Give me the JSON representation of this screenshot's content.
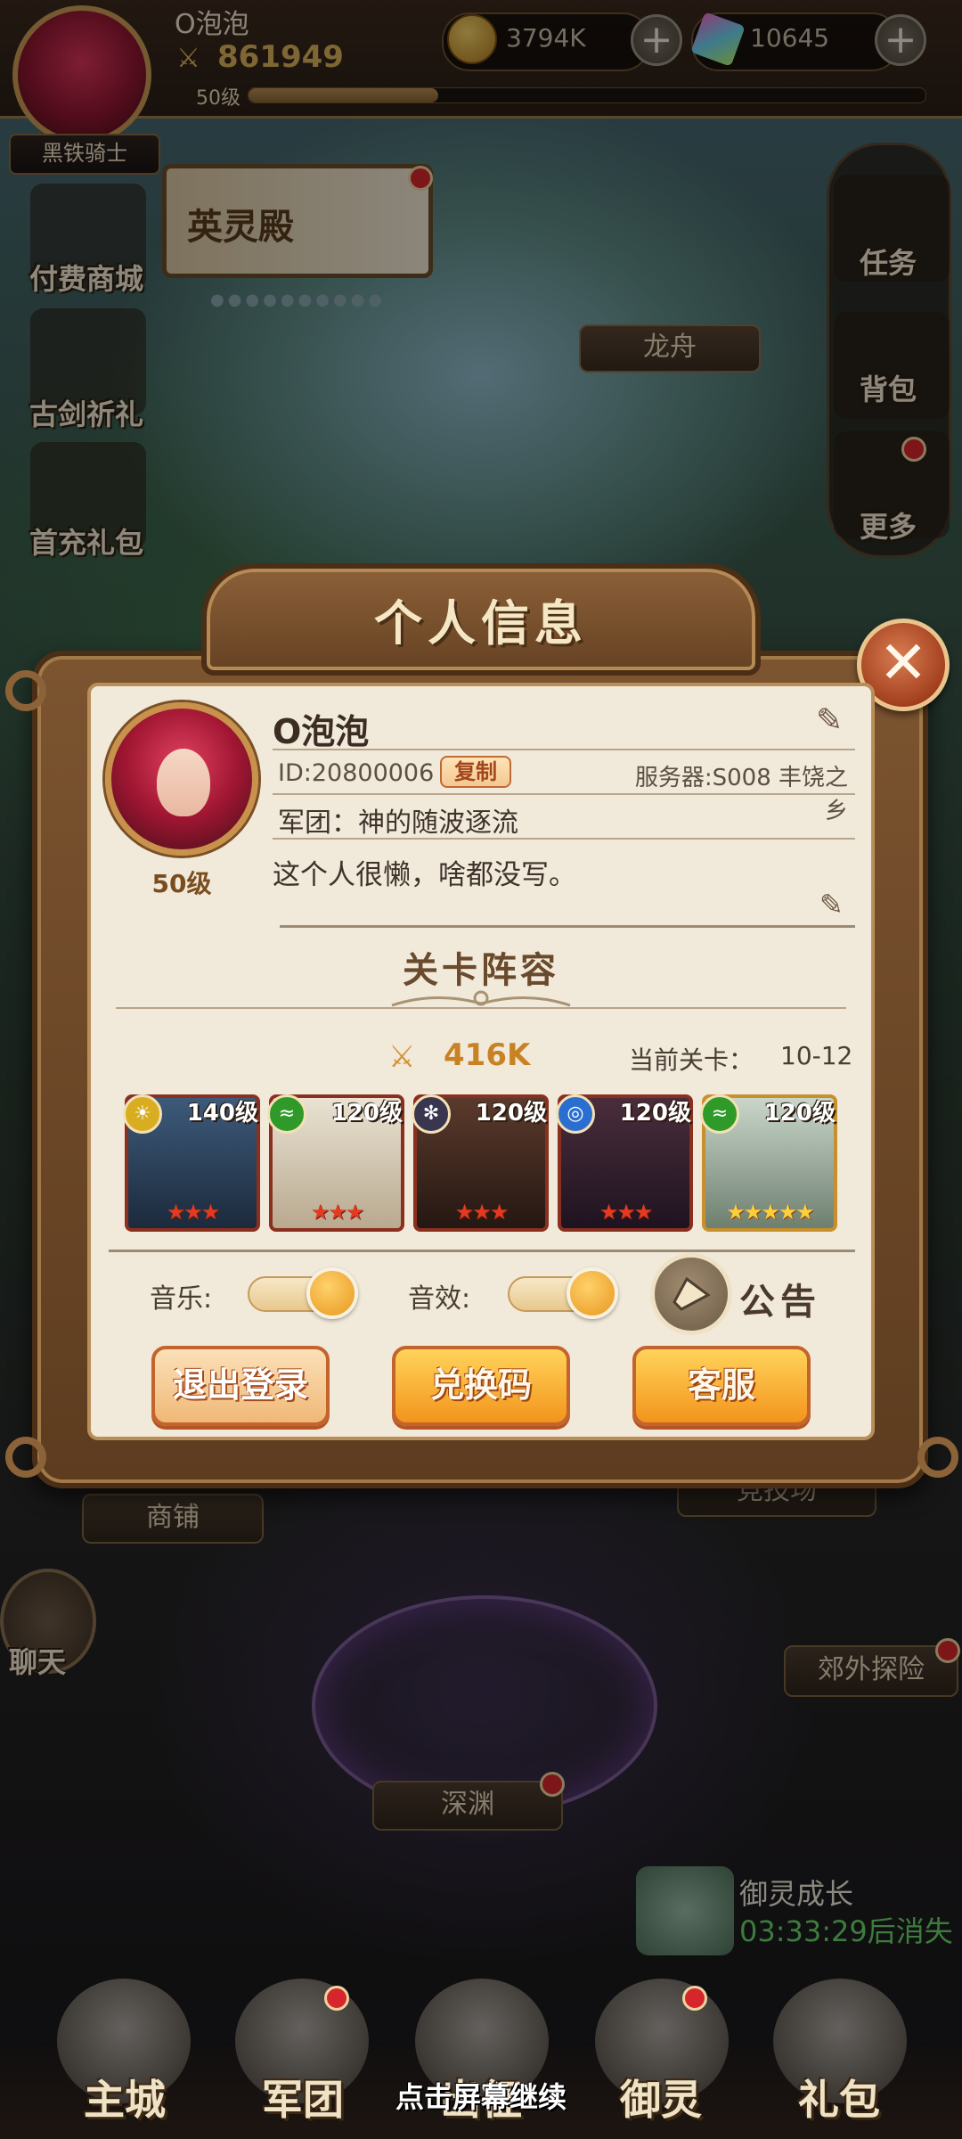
{
  "player": {
    "name": "O泡泡",
    "power": "861949",
    "level_label": "50级",
    "xp_fraction": 0.28,
    "rank_title": "黑铁骑士"
  },
  "resources": {
    "gold": "3794K",
    "gems": "10645"
  },
  "left_menu": [
    "付费商城",
    "古剑祈礼",
    "首充礼包"
  ],
  "banner": {
    "label": "英灵殿"
  },
  "map_labels": {
    "dragon_boat": "龙舟",
    "shop": "商铺",
    "abyss": "深渊",
    "outskirts": "郊外探险",
    "arena": "竞技场"
  },
  "right_menu": [
    "任务",
    "背包",
    "更多"
  ],
  "chat": {
    "label": "聊天"
  },
  "growth": {
    "title": "御灵成长",
    "timer": "03:33:29后消失"
  },
  "dialog": {
    "title": "个人信息",
    "name": "O泡泡",
    "id": "ID:20800006",
    "copy_label": "复制",
    "server": "服务器:S008 丰饶之乡",
    "guild": "军团：神的随波逐流",
    "signature": "这个人很懒，啥都没写。",
    "level": "50级",
    "section_title": "关卡阵容",
    "lineup_power": "416K",
    "stage_label": "当前关卡：",
    "stage_value": "10-12",
    "heroes": [
      {
        "level": "140级",
        "faction": "gold",
        "stars": "★★★"
      },
      {
        "level": "120级",
        "faction": "green",
        "stars": "★★★"
      },
      {
        "level": "120级",
        "faction": "dark",
        "stars": "★★★"
      },
      {
        "level": "120级",
        "faction": "blue",
        "stars": "★★★"
      },
      {
        "level": "120级",
        "faction": "green",
        "stars": "★★★★★"
      }
    ],
    "music_label": "音乐:",
    "sfx_label": "音效:",
    "notice_label": "公告",
    "logout_label": "退出登录",
    "redeem_label": "兑换码",
    "support_label": "客服"
  },
  "bottom_nav": [
    "主城",
    "军团",
    "出征",
    "御灵",
    "礼包"
  ],
  "continue_hint": "点击屏幕继续",
  "colors": {
    "accent_orange": "#f3941c",
    "frame_brown": "#6a4526",
    "panel_cream": "#f1e9da",
    "timer_green": "#6ad66a",
    "alert_red": "#d6262c"
  }
}
